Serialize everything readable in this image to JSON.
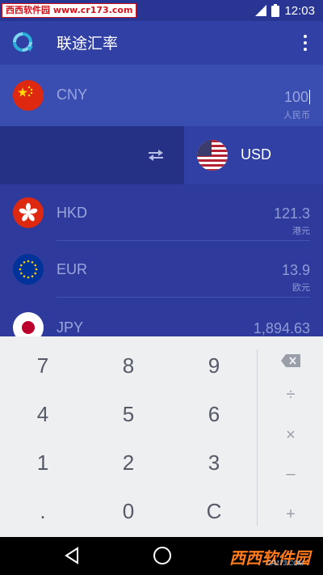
{
  "status_bar": {
    "watermark": "西西软件园 www.cr173.com",
    "time": "12:03"
  },
  "app_bar": {
    "title": "联途汇率",
    "logo_icon": "refresh-cycle-icon",
    "menu_icon": "more-vert-icon"
  },
  "base_currency": {
    "code": "CNY",
    "amount": "100",
    "unit": "人民币",
    "flag": "china-flag-icon"
  },
  "target_currency": {
    "code": "USD",
    "flag": "us-flag-icon",
    "swap_icon": "swap-arrows-icon"
  },
  "currencies": [
    {
      "code": "HKD",
      "value": "121.3",
      "unit": "港元",
      "flag": "hong-kong-flag-icon"
    },
    {
      "code": "EUR",
      "value": "13.9",
      "unit": "欧元",
      "flag": "eu-flag-icon"
    },
    {
      "code": "JPY",
      "value": "1,894.63",
      "unit": "",
      "flag": "japan-flag-icon"
    }
  ],
  "keypad": {
    "keys": [
      "7",
      "8",
      "9",
      "4",
      "5",
      "6",
      "1",
      "2",
      "3",
      ".",
      "0",
      "C"
    ],
    "backspace_icon": "backspace-icon",
    "operators": [
      "÷",
      "×",
      "–",
      "+"
    ]
  },
  "nav_bar": {
    "brand": "西西软件园",
    "brand_sub": "CR173.COM"
  },
  "colors": {
    "primary": "#3040a4",
    "primary_dark": "#283593",
    "selected_row": "#3a4db1",
    "keypad_bg": "#eeeff1"
  }
}
